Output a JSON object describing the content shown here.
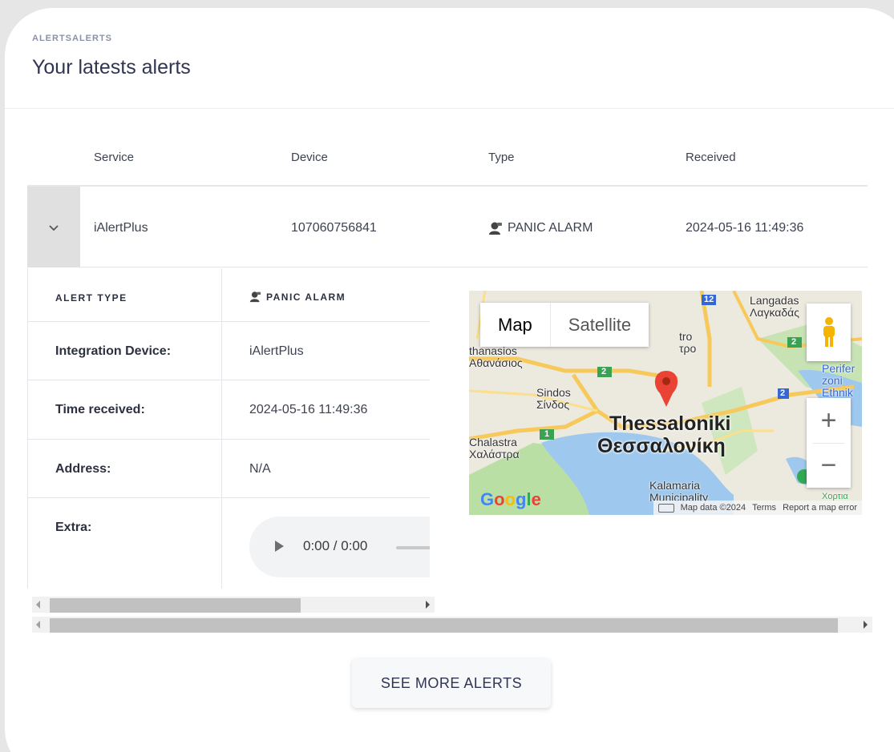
{
  "header": {
    "eyebrow": "ALERTSALERTS",
    "title": "Your latests alerts"
  },
  "table": {
    "columns": [
      "Service",
      "Device",
      "Type",
      "Received"
    ],
    "row": {
      "service": "iAlertPlus",
      "device": "107060756841",
      "type": "PANIC ALARM",
      "received": "2024-05-16 11:49:36"
    }
  },
  "detail": {
    "alert_type_label": "ALERT TYPE",
    "alert_type_value": "PANIC ALARM",
    "integration_label": "Integration Device:",
    "integration_value": "iAlertPlus",
    "time_label": "Time received:",
    "time_value": "2024-05-16 11:49:36",
    "address_label": "Address:",
    "address_value": "N/A",
    "extra_label": "Extra:",
    "audio_time": "0:00 / 0:00"
  },
  "map": {
    "tab_map": "Map",
    "tab_satellite": "Satellite",
    "city_en": "Thessaloniki",
    "city_gr": "Θεσσαλονίκη",
    "labels": {
      "langadas": "Langadas",
      "langadas_gr": "Λαγκαδάς",
      "athanasios": "thanasios",
      "athanasios_gr": "Αθανάσιος",
      "sindos": "Sindos",
      "sindos_gr": "Σίνδος",
      "chalastra": "Chalastra",
      "chalastra_gr": "Χαλάστρα",
      "kalamaria": "Kalamaria",
      "kalamaria_municipality": "Municipality",
      "pefka": "Perifer",
      "zoni": "zoni",
      "ethnik": "Ethnik",
      "xortia": "Χορτια",
      "tro": "tro",
      "tro_gr": "τρο"
    },
    "attribution": {
      "data": "Map data ©2024",
      "terms": "Terms",
      "report": "Report a map error"
    },
    "google": "Google",
    "shield_12": "12",
    "shield_2": "2",
    "shield_1": "1"
  },
  "actions": {
    "see_more": "SEE MORE ALERTS"
  }
}
